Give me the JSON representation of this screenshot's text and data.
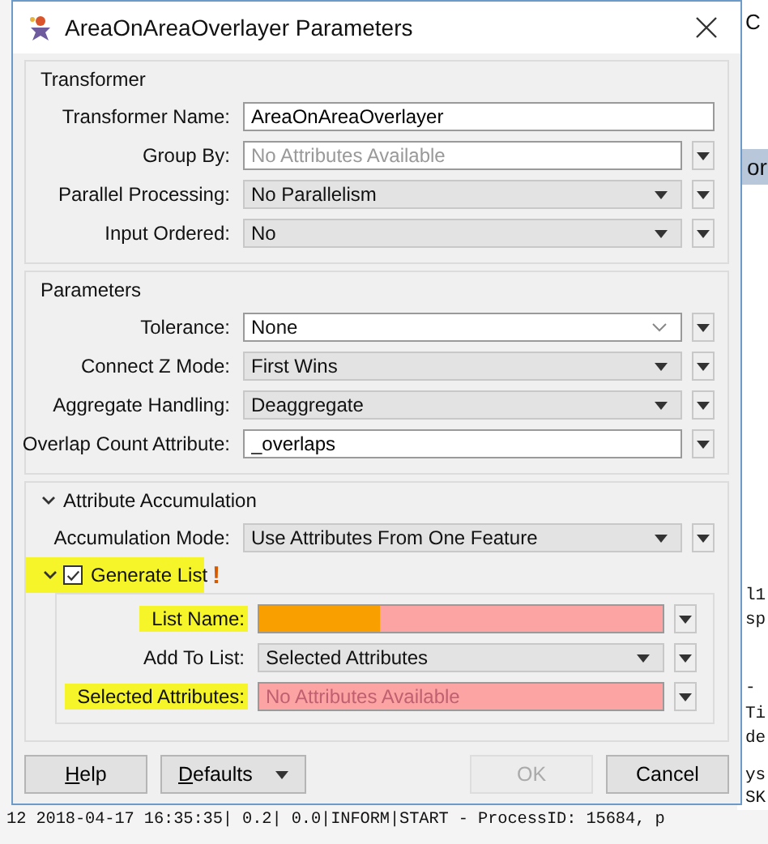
{
  "window": {
    "title": "AreaOnAreaOverlayer Parameters"
  },
  "sections": [
    {
      "title": "Transformer",
      "rows": [
        {
          "label": "Transformer Name:",
          "kind": "text",
          "value": "AreaOnAreaOverlayer",
          "invalid": false,
          "highlighted": false,
          "marked": false
        },
        {
          "label": "Group By:",
          "kind": "text",
          "placeholder": "No Attributes Available",
          "menu": true,
          "invalid": false,
          "highlighted": false,
          "marked": false
        },
        {
          "label": "Parallel Processing:",
          "kind": "combo",
          "value": "No Parallelism",
          "menu": true,
          "invalid": false,
          "highlighted": false
        },
        {
          "label": "Input Ordered:",
          "kind": "combo",
          "value": "No",
          "menu": true,
          "invalid": false,
          "highlighted": false
        }
      ]
    },
    {
      "title": "Parameters",
      "rows": [
        {
          "label": "Tolerance:",
          "kind": "editable",
          "value": "None",
          "menu": true,
          "invalid": false,
          "highlighted": false
        },
        {
          "label": "Connect Z Mode:",
          "kind": "combo",
          "value": "First Wins",
          "menu": true,
          "invalid": false,
          "highlighted": false
        },
        {
          "label": "Aggregate Handling:",
          "kind": "combo",
          "value": "Deaggregate",
          "menu": true,
          "invalid": false,
          "highlighted": false
        },
        {
          "label": "Overlap Count Attribute:",
          "kind": "text",
          "value": "_overlaps",
          "menu": true,
          "invalid": false,
          "highlighted": false,
          "marked": false
        }
      ]
    },
    {
      "title": "Attribute Accumulation",
      "collapsible": true,
      "expanded": true,
      "rows": [
        {
          "label": "Accumulation Mode:",
          "kind": "combo",
          "value": "Use Attributes From One Feature",
          "menu": true,
          "invalid": false,
          "highlighted": false
        }
      ],
      "subgroup": {
        "label": "Generate List",
        "checked": true,
        "expanded": true,
        "warning": "!",
        "highlighted": true,
        "rows": [
          {
            "label": "List Name:",
            "kind": "text",
            "value": "",
            "menu": true,
            "invalid": true,
            "highlighted": true,
            "marked": true
          },
          {
            "label": "Add To List:",
            "kind": "combo",
            "value": "Selected Attributes",
            "menu": true,
            "invalid": false,
            "highlighted": false
          },
          {
            "label": "Selected Attributes:",
            "kind": "text",
            "placeholder": "No Attributes Available",
            "menu": true,
            "invalid": true,
            "highlighted": true,
            "marked": false
          }
        ]
      }
    }
  ],
  "buttons": [
    {
      "label": "Help",
      "kind": "plain",
      "underline_first": true,
      "disabled": false
    },
    {
      "label": "Defaults",
      "kind": "split",
      "underline_first": true,
      "disabled": false
    },
    {
      "label": "OK",
      "kind": "plain",
      "underline_first": false,
      "disabled": true
    },
    {
      "label": "Cancel",
      "kind": "plain",
      "underline_first": false,
      "disabled": false
    }
  ],
  "background": {
    "fragments": [
      {
        "text": "C",
        "kind": "title"
      },
      {
        "text": "or",
        "kind": "tab"
      },
      {
        "text": "l1",
        "kind": "log"
      },
      {
        "text": "sp",
        "kind": "log"
      },
      {
        "text": "-",
        "kind": "log"
      },
      {
        "text": "Ti",
        "kind": "log"
      },
      {
        "text": "de",
        "kind": "log"
      },
      {
        "text": "ys",
        "kind": "log"
      },
      {
        "text": "SK",
        "kind": "log"
      }
    ],
    "log": [
      "12  2018-04-17 16:35:35|   0.2|   0.0|INFORM|START - ProcessID: 15684, p"
    ]
  }
}
